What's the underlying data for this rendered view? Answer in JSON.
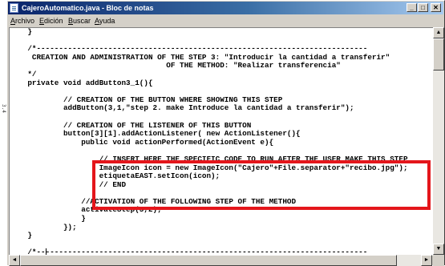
{
  "window": {
    "title": "CajeroAutomatico.java - Bloc de notas",
    "buttons": {
      "minimize": "_",
      "maximize": "□",
      "close": "✕"
    }
  },
  "menubar": {
    "items": [
      "Archivo",
      "Edición",
      "Buscar",
      "Ayuda"
    ]
  },
  "editor": {
    "lines": [
      "    }",
      "",
      "    /*--------------------------------------------------------------------------",
      "     CREATION AND ADMINISTRATION OF THE STEP 3: \"Introducir la cantidad a transferir\"",
      "                                   OF THE METHOD: \"Realizar transferencia\"",
      "    */",
      "    private void addButton3_1(){",
      "",
      "            // CREATION OF THE BUTTON WHERE SHOWING THIS STEP",
      "            addButton(3,1,\"step 2. make Introduce la cantidad a transferir\");",
      "",
      "            // CREATION OF THE LISTENER OF THIS BUTTON",
      "            button[3][1].addActionListener( new ActionListener(){",
      "                public void actionPerformed(ActionEvent e){",
      "",
      "                    // INSERT HERE THE SPECIFIC CODE TO RUN AFTER THE USER MAKE THIS STEP",
      "                    ImageIcon icon = new ImageIcon(\"Cajero\"+File.separator+\"recibo.jpg\");",
      "                    etiquetaEAST.setIcon(icon);",
      "                    // END",
      "",
      "                //ACTIVATION OF THE FOLLOWING STEP OF THE METHOD",
      "                activateStep(3,2);",
      "                }",
      "            });",
      "    }",
      "",
      "    /*--------------------------------------------------------------------------"
    ]
  },
  "scrollbars": {
    "up": "▲",
    "down": "▼",
    "left": "◄",
    "right": "►"
  },
  "side_text": "3.4"
}
